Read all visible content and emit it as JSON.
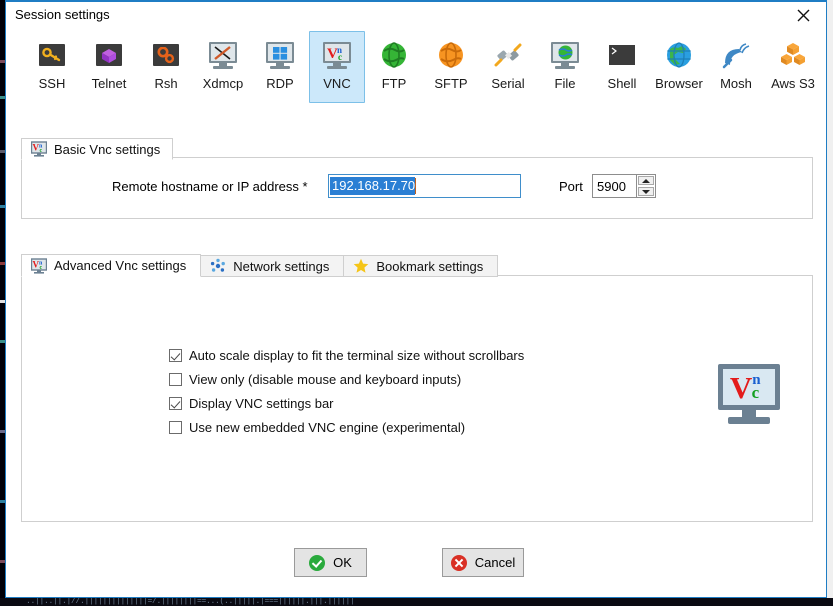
{
  "window": {
    "title": "Session settings",
    "close_icon": "close-icon"
  },
  "protocols": [
    {
      "id": "ssh",
      "label": "SSH",
      "icon": "key-icon",
      "selected": false
    },
    {
      "id": "telnet",
      "label": "Telnet",
      "icon": "cube-icon",
      "selected": false
    },
    {
      "id": "rsh",
      "label": "Rsh",
      "icon": "gears-icon",
      "selected": false
    },
    {
      "id": "xdmcp",
      "label": "Xdmcp",
      "icon": "x-monitor-icon",
      "selected": false
    },
    {
      "id": "rdp",
      "label": "RDP",
      "icon": "windows-monitor-icon",
      "selected": false
    },
    {
      "id": "vnc",
      "label": "VNC",
      "icon": "vnc-monitor-icon",
      "selected": true
    },
    {
      "id": "ftp",
      "label": "FTP",
      "icon": "green-globe-icon",
      "selected": false
    },
    {
      "id": "sftp",
      "label": "SFTP",
      "icon": "orange-globe-icon",
      "selected": false
    },
    {
      "id": "serial",
      "label": "Serial",
      "icon": "plug-icon",
      "selected": false
    },
    {
      "id": "file",
      "label": "File",
      "icon": "globe-monitor-icon",
      "selected": false
    },
    {
      "id": "shell",
      "label": "Shell",
      "icon": "terminal-icon",
      "selected": false
    },
    {
      "id": "browser",
      "label": "Browser",
      "icon": "blue-globe-icon",
      "selected": false
    },
    {
      "id": "mosh",
      "label": "Mosh",
      "icon": "satellite-dish-icon",
      "selected": false
    },
    {
      "id": "awss3",
      "label": "Aws S3",
      "icon": "aws-cubes-icon",
      "selected": false
    }
  ],
  "basic_group": {
    "tab_label": "Basic Vnc settings",
    "tab_icon": "vnc-monitor-icon",
    "host_label": "Remote hostname or IP address *",
    "host_value": "192.168.17.70",
    "host_placeholder": "",
    "port_label": "Port",
    "port_value": "5900"
  },
  "advanced_group": {
    "tabs": [
      {
        "id": "advanced",
        "label": "Advanced Vnc settings",
        "icon": "vnc-monitor-icon",
        "active": true
      },
      {
        "id": "network",
        "label": "Network settings",
        "icon": "network-dots-icon",
        "active": false
      },
      {
        "id": "bookmark",
        "label": "Bookmark settings",
        "icon": "star-icon",
        "active": false
      }
    ],
    "options": [
      {
        "id": "auto-scale",
        "label": "Auto scale display to fit the terminal size without scrollbars",
        "checked": true
      },
      {
        "id": "view-only",
        "label": "View only (disable mouse and keyboard inputs)",
        "checked": false
      },
      {
        "id": "settings-bar",
        "label": "Display VNC settings bar",
        "checked": true
      },
      {
        "id": "new-engine",
        "label": "Use new embedded VNC engine (experimental)",
        "checked": false
      }
    ],
    "logo": {
      "icon": "vnc-logo-icon",
      "letter_v": "V",
      "letter_n": "n",
      "letter_c": "c"
    }
  },
  "footer": {
    "ok_label": "OK",
    "ok_icon": "green-check-icon",
    "cancel_label": "Cancel",
    "cancel_icon": "red-x-icon"
  },
  "background": {
    "strip_text": "..||..||.|//.||||||||||||||=/.||||||||==...(..|||||.|===||||||.|||.||||||"
  },
  "colors": {
    "accent": "#1f7dc4",
    "selection": "#2a7fd4",
    "tab_selected_bg": "#cce8fa",
    "ok_green": "#2aaa3d",
    "cancel_red": "#d93025"
  }
}
